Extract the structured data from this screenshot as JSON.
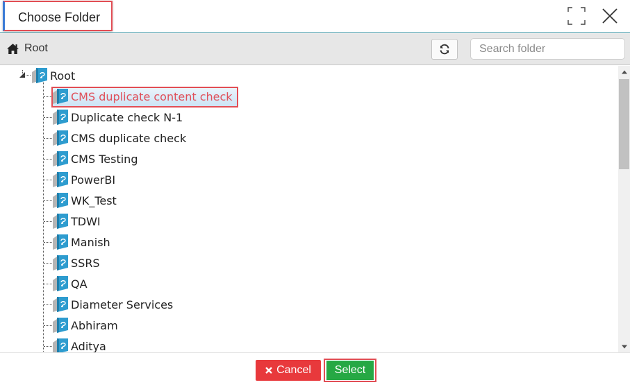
{
  "dialog": {
    "title": "Choose Folder"
  },
  "toolbar": {
    "breadcrumb_root": "Root",
    "search_placeholder": "Search folder"
  },
  "tree": {
    "root_label": "Root",
    "selected_index": 0,
    "items": [
      {
        "label": "CMS duplicate content check"
      },
      {
        "label": "Duplicate check N-1"
      },
      {
        "label": "CMS duplicate check"
      },
      {
        "label": "CMS Testing"
      },
      {
        "label": "PowerBI"
      },
      {
        "label": "WK_Test"
      },
      {
        "label": "TDWI"
      },
      {
        "label": "Manish"
      },
      {
        "label": "SSRS"
      },
      {
        "label": "QA"
      },
      {
        "label": "Diameter Services"
      },
      {
        "label": "Abhiram"
      },
      {
        "label": "Aditya"
      }
    ]
  },
  "footer": {
    "cancel_label": "Cancel",
    "select_label": "Select"
  },
  "colors": {
    "accent": "#5ca7b4",
    "folder": "#2e9ccf",
    "cancel": "#e8393c",
    "select": "#26a844",
    "highlight": "#e24e55"
  },
  "icons": [
    "maximize-icon",
    "close-icon",
    "home-icon",
    "refresh-icon",
    "folder-icon",
    "times-icon"
  ]
}
